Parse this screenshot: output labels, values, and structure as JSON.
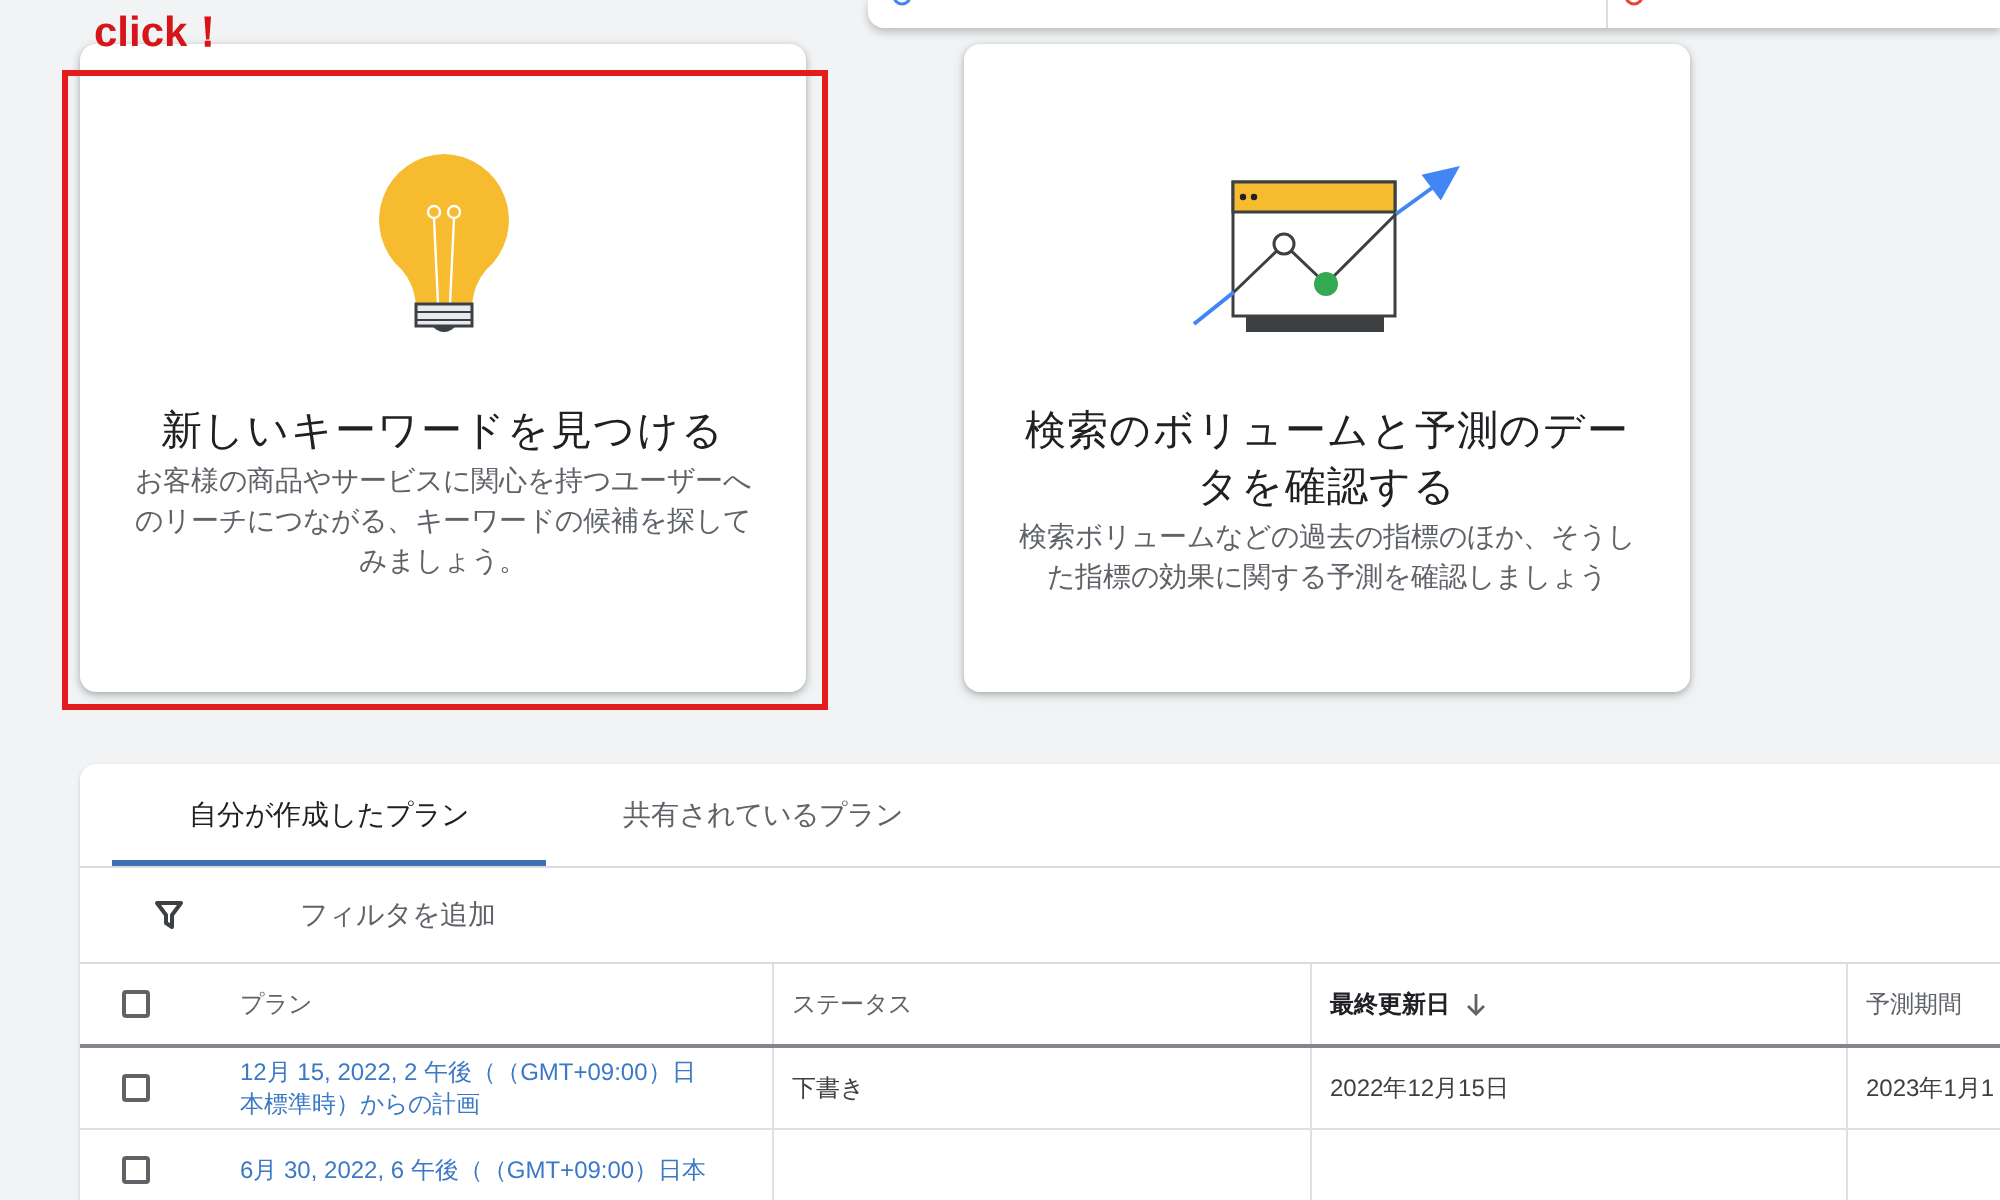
{
  "callout": {
    "label": "click！"
  },
  "cards": [
    {
      "kind": "keywords",
      "highlighted": true,
      "title": "新しいキーワードを見つける",
      "description": "お客様の商品やサービスに関心を持つユーザーへのリーチにつながる、キーワードの候補を探してみましょう。"
    },
    {
      "kind": "forecast",
      "highlighted": false,
      "title": "検索のボリュームと予測のデータを確認する",
      "description": "検索ボリュームなどの過去の指標のほか、そうした指標の効果に関する予測を確認しましょう"
    }
  ],
  "plans": {
    "tabs": [
      {
        "label": "自分が作成したプラン",
        "selected": true
      },
      {
        "label": "共有されているプラン",
        "selected": false
      }
    ],
    "filter": {
      "label": "フィルタを追加"
    },
    "table": {
      "select_all": {
        "checked": false
      },
      "columns": [
        {
          "label": "プラン",
          "sorted": false
        },
        {
          "label": "ステータス",
          "sorted": false
        },
        {
          "label": "最終更新日",
          "sorted": true
        },
        {
          "label": "予測期間",
          "sorted": false
        }
      ],
      "rows": [
        {
          "checked": false,
          "plan": "12月 15, 2022, 2 午後（（GMT+09:00）日本標準時）からの計画",
          "status": "下書き",
          "last_updated": "2022年12月15日",
          "forecast_period": "2023年1月1"
        },
        {
          "checked": false,
          "plan": "6月 30, 2022, 6 午後（（GMT+09:00）日本"
        }
      ]
    }
  }
}
